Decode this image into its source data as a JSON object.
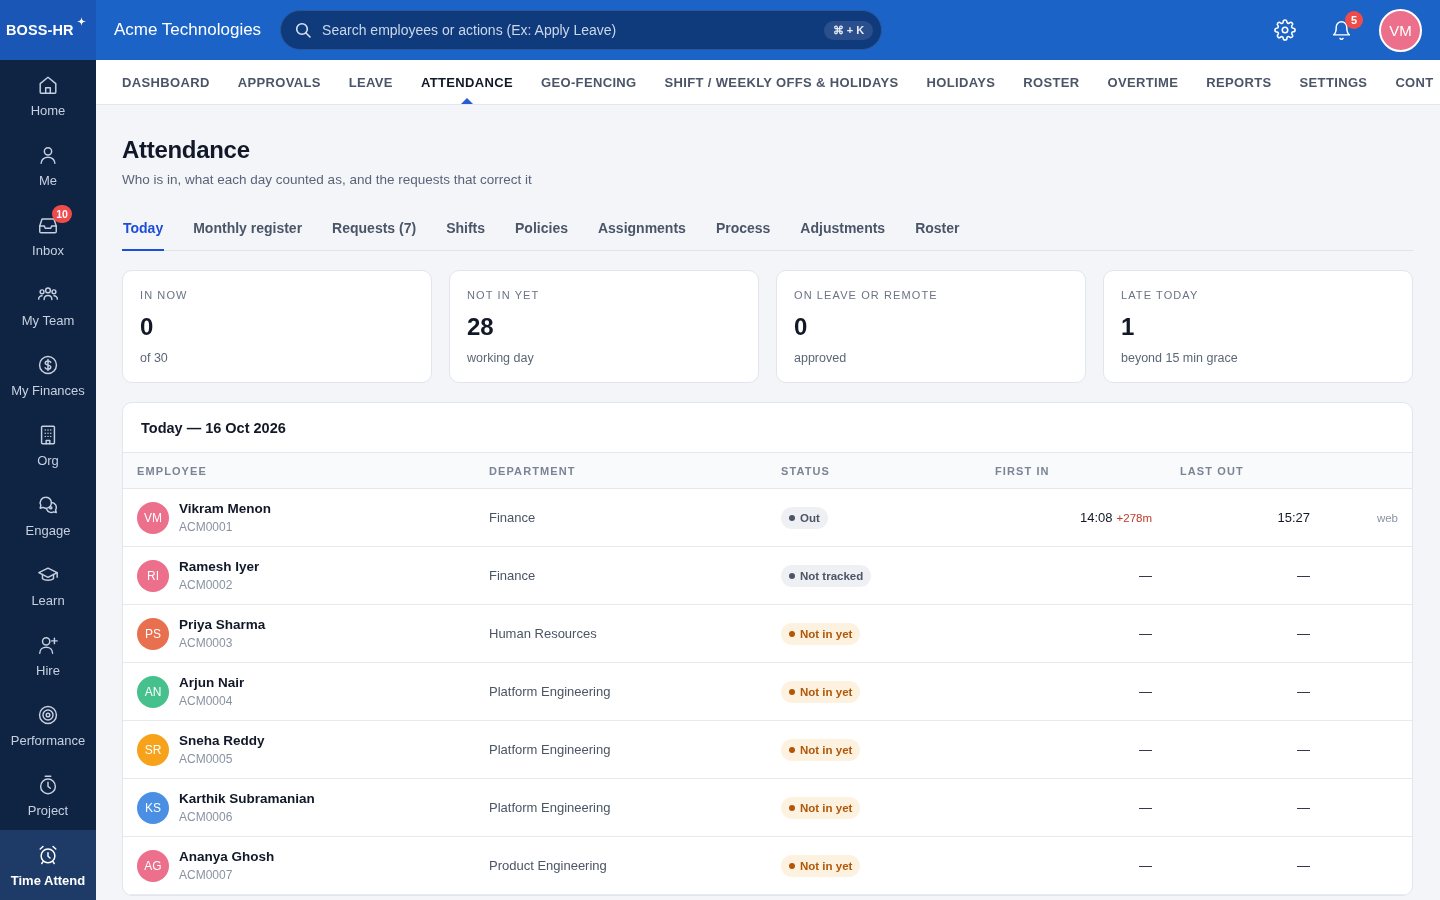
{
  "topbar": {
    "logo": "BOSS-HR",
    "company": "Acme Technologies",
    "search": {
      "placeholder": "Search employees or actions (Ex: Apply Leave)",
      "shortcut": "⌘ + K"
    },
    "notifications_badge": "5",
    "user_initials": "VM"
  },
  "sidebar": {
    "items": [
      {
        "label": "Home",
        "selected": false
      },
      {
        "label": "Me",
        "selected": false
      },
      {
        "label": "Inbox",
        "selected": false,
        "badge": "10"
      },
      {
        "label": "My Team",
        "selected": false
      },
      {
        "label": "My Finances",
        "selected": false
      },
      {
        "label": "Org",
        "selected": false
      },
      {
        "label": "Engage",
        "selected": false
      },
      {
        "label": "Learn",
        "selected": false
      },
      {
        "label": "Hire",
        "selected": false
      },
      {
        "label": "Performance",
        "selected": false
      },
      {
        "label": "Project",
        "selected": false
      },
      {
        "label": "Time Attend",
        "selected": true
      }
    ]
  },
  "nav": {
    "items": [
      {
        "label": "DASHBOARD",
        "selected": false
      },
      {
        "label": "APPROVALS",
        "selected": false
      },
      {
        "label": "LEAVE",
        "selected": false
      },
      {
        "label": "ATTENDANCE",
        "selected": true
      },
      {
        "label": "GEO-FENCING",
        "selected": false
      },
      {
        "label": "SHIFT / WEEKLY OFFS & HOLIDAYS",
        "selected": false
      },
      {
        "label": "HOLIDAYS",
        "selected": false
      },
      {
        "label": "ROSTER",
        "selected": false
      },
      {
        "label": "OVERTIME",
        "selected": false
      },
      {
        "label": "REPORTS",
        "selected": false
      },
      {
        "label": "SETTINGS",
        "selected": false
      },
      {
        "label": "CONT",
        "selected": false
      }
    ]
  },
  "page": {
    "title": "Attendance",
    "subtitle": "Who is in, what each day counted as, and the requests that correct it"
  },
  "tabs": [
    {
      "label": "Today",
      "selected": true
    },
    {
      "label": "Monthly register",
      "selected": false
    },
    {
      "label": "Requests (7)",
      "selected": false
    },
    {
      "label": "Shifts",
      "selected": false
    },
    {
      "label": "Policies",
      "selected": false
    },
    {
      "label": "Assignments",
      "selected": false
    },
    {
      "label": "Process",
      "selected": false
    },
    {
      "label": "Adjustments",
      "selected": false
    },
    {
      "label": "Roster",
      "selected": false
    }
  ],
  "stats": [
    {
      "label": "IN NOW",
      "value": "0",
      "note": "of 30"
    },
    {
      "label": "NOT IN YET",
      "value": "28",
      "note": "working day"
    },
    {
      "label": "ON LEAVE OR REMOTE",
      "value": "0",
      "note": "approved"
    },
    {
      "label": "LATE TODAY",
      "value": "1",
      "note": "beyond 15 min grace"
    }
  ],
  "table": {
    "title": "Today — 16 Oct 2026",
    "columns": [
      "EMPLOYEE",
      "DEPARTMENT",
      "STATUS",
      "FIRST IN",
      "LAST OUT"
    ],
    "rows": [
      {
        "initials": "VM",
        "color": "#ec6f8b",
        "name": "Vikram Menon",
        "id": "ACM0001",
        "department": "Finance",
        "status": {
          "label": "Out",
          "kind": "neutral"
        },
        "first_in": "14:08",
        "late_by": "+278m",
        "last_out": "15:27",
        "source": "web"
      },
      {
        "initials": "RI",
        "color": "#ec6f8b",
        "name": "Ramesh Iyer",
        "id": "ACM0002",
        "department": "Finance",
        "status": {
          "label": "Not tracked",
          "kind": "neutral"
        },
        "first_in": "—",
        "last_out": "—"
      },
      {
        "initials": "PS",
        "color": "#e8704f",
        "name": "Priya Sharma",
        "id": "ACM0003",
        "department": "Human Resources",
        "status": {
          "label": "Not in yet",
          "kind": "warning"
        },
        "first_in": "—",
        "last_out": "—"
      },
      {
        "initials": "AN",
        "color": "#46c08c",
        "name": "Arjun Nair",
        "id": "ACM0004",
        "department": "Platform Engineering",
        "status": {
          "label": "Not in yet",
          "kind": "warning"
        },
        "first_in": "—",
        "last_out": "—"
      },
      {
        "initials": "SR",
        "color": "#f7a21b",
        "name": "Sneha Reddy",
        "id": "ACM0005",
        "department": "Platform Engineering",
        "status": {
          "label": "Not in yet",
          "kind": "warning"
        },
        "first_in": "—",
        "last_out": "—"
      },
      {
        "initials": "KS",
        "color": "#4a8fe3",
        "name": "Karthik Subramanian",
        "id": "ACM0006",
        "department": "Platform Engineering",
        "status": {
          "label": "Not in yet",
          "kind": "warning"
        },
        "first_in": "—",
        "last_out": "—"
      },
      {
        "initials": "AG",
        "color": "#ec6f8b",
        "name": "Ananya Ghosh",
        "id": "ACM0007",
        "department": "Product Engineering",
        "status": {
          "label": "Not in yet",
          "kind": "warning"
        },
        "first_in": "—",
        "last_out": "—"
      }
    ]
  }
}
